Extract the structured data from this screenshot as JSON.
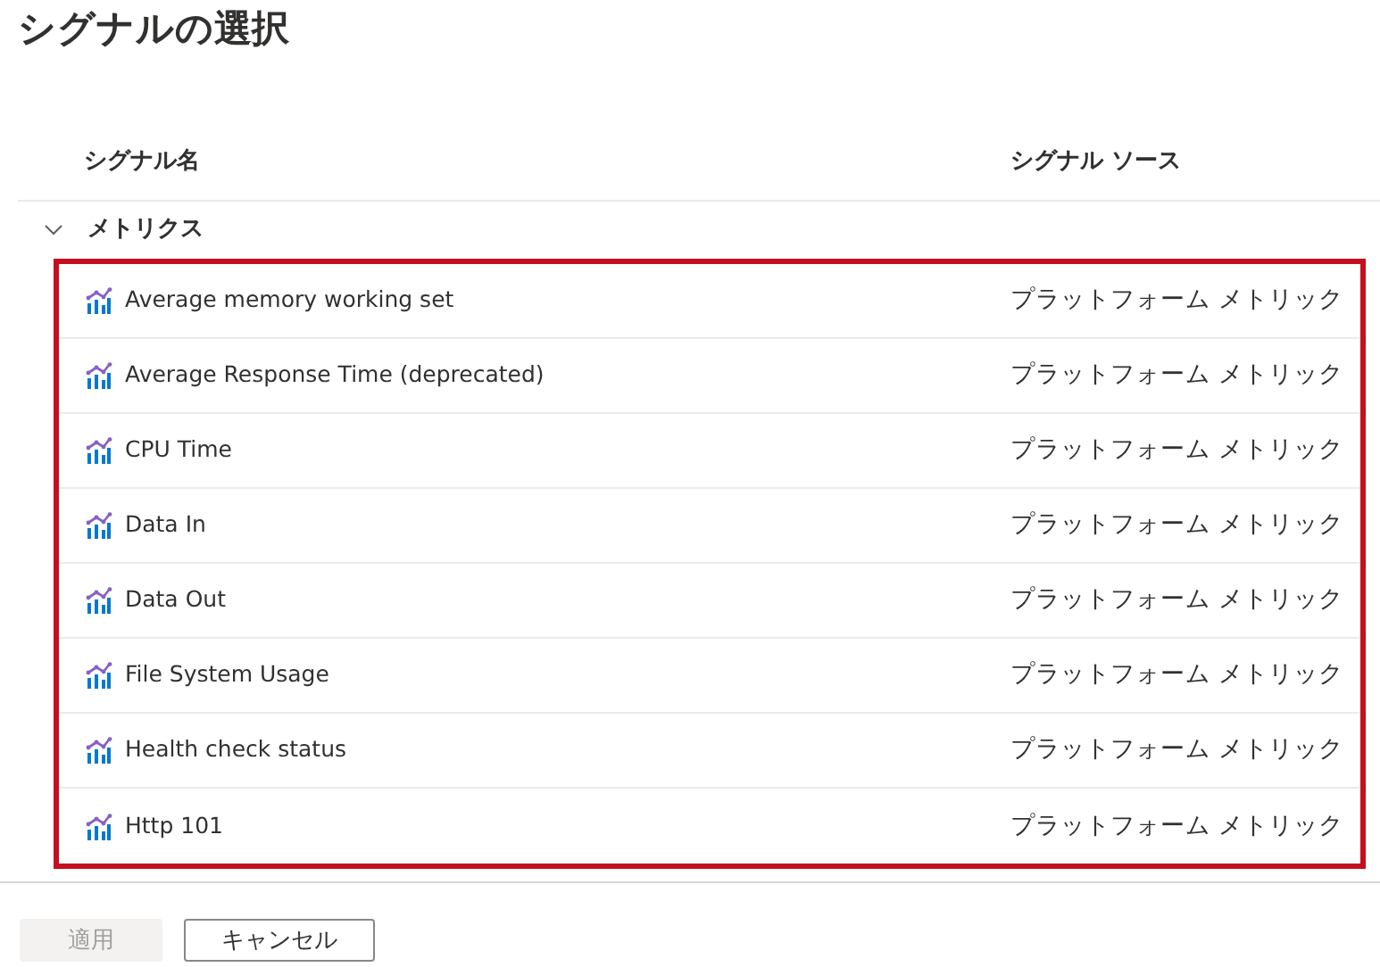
{
  "title": "シグナルの選択",
  "columns": [
    "シグナル名",
    "シグナル ソース"
  ],
  "group": {
    "label": "メトリクス",
    "expanded": true,
    "highlighted": true,
    "rows": [
      {
        "name": "Average memory working set",
        "source": "プラットフォーム メトリック"
      },
      {
        "name": "Average Response Time (deprecated)",
        "source": "プラットフォーム メトリック"
      },
      {
        "name": "CPU Time",
        "source": "プラットフォーム メトリック"
      },
      {
        "name": "Data In",
        "source": "プラットフォーム メトリック"
      },
      {
        "name": "Data Out",
        "source": "プラットフォーム メトリック"
      },
      {
        "name": "File System Usage",
        "source": "プラットフォーム メトリック"
      },
      {
        "name": "Health check status",
        "source": "プラットフォーム メトリック"
      },
      {
        "name": "Http 101",
        "source": "プラットフォーム メトリック"
      }
    ]
  },
  "buttons": [
    {
      "label": "適用",
      "disabled": true
    },
    {
      "label": "キャンセル",
      "disabled": false
    }
  ]
}
